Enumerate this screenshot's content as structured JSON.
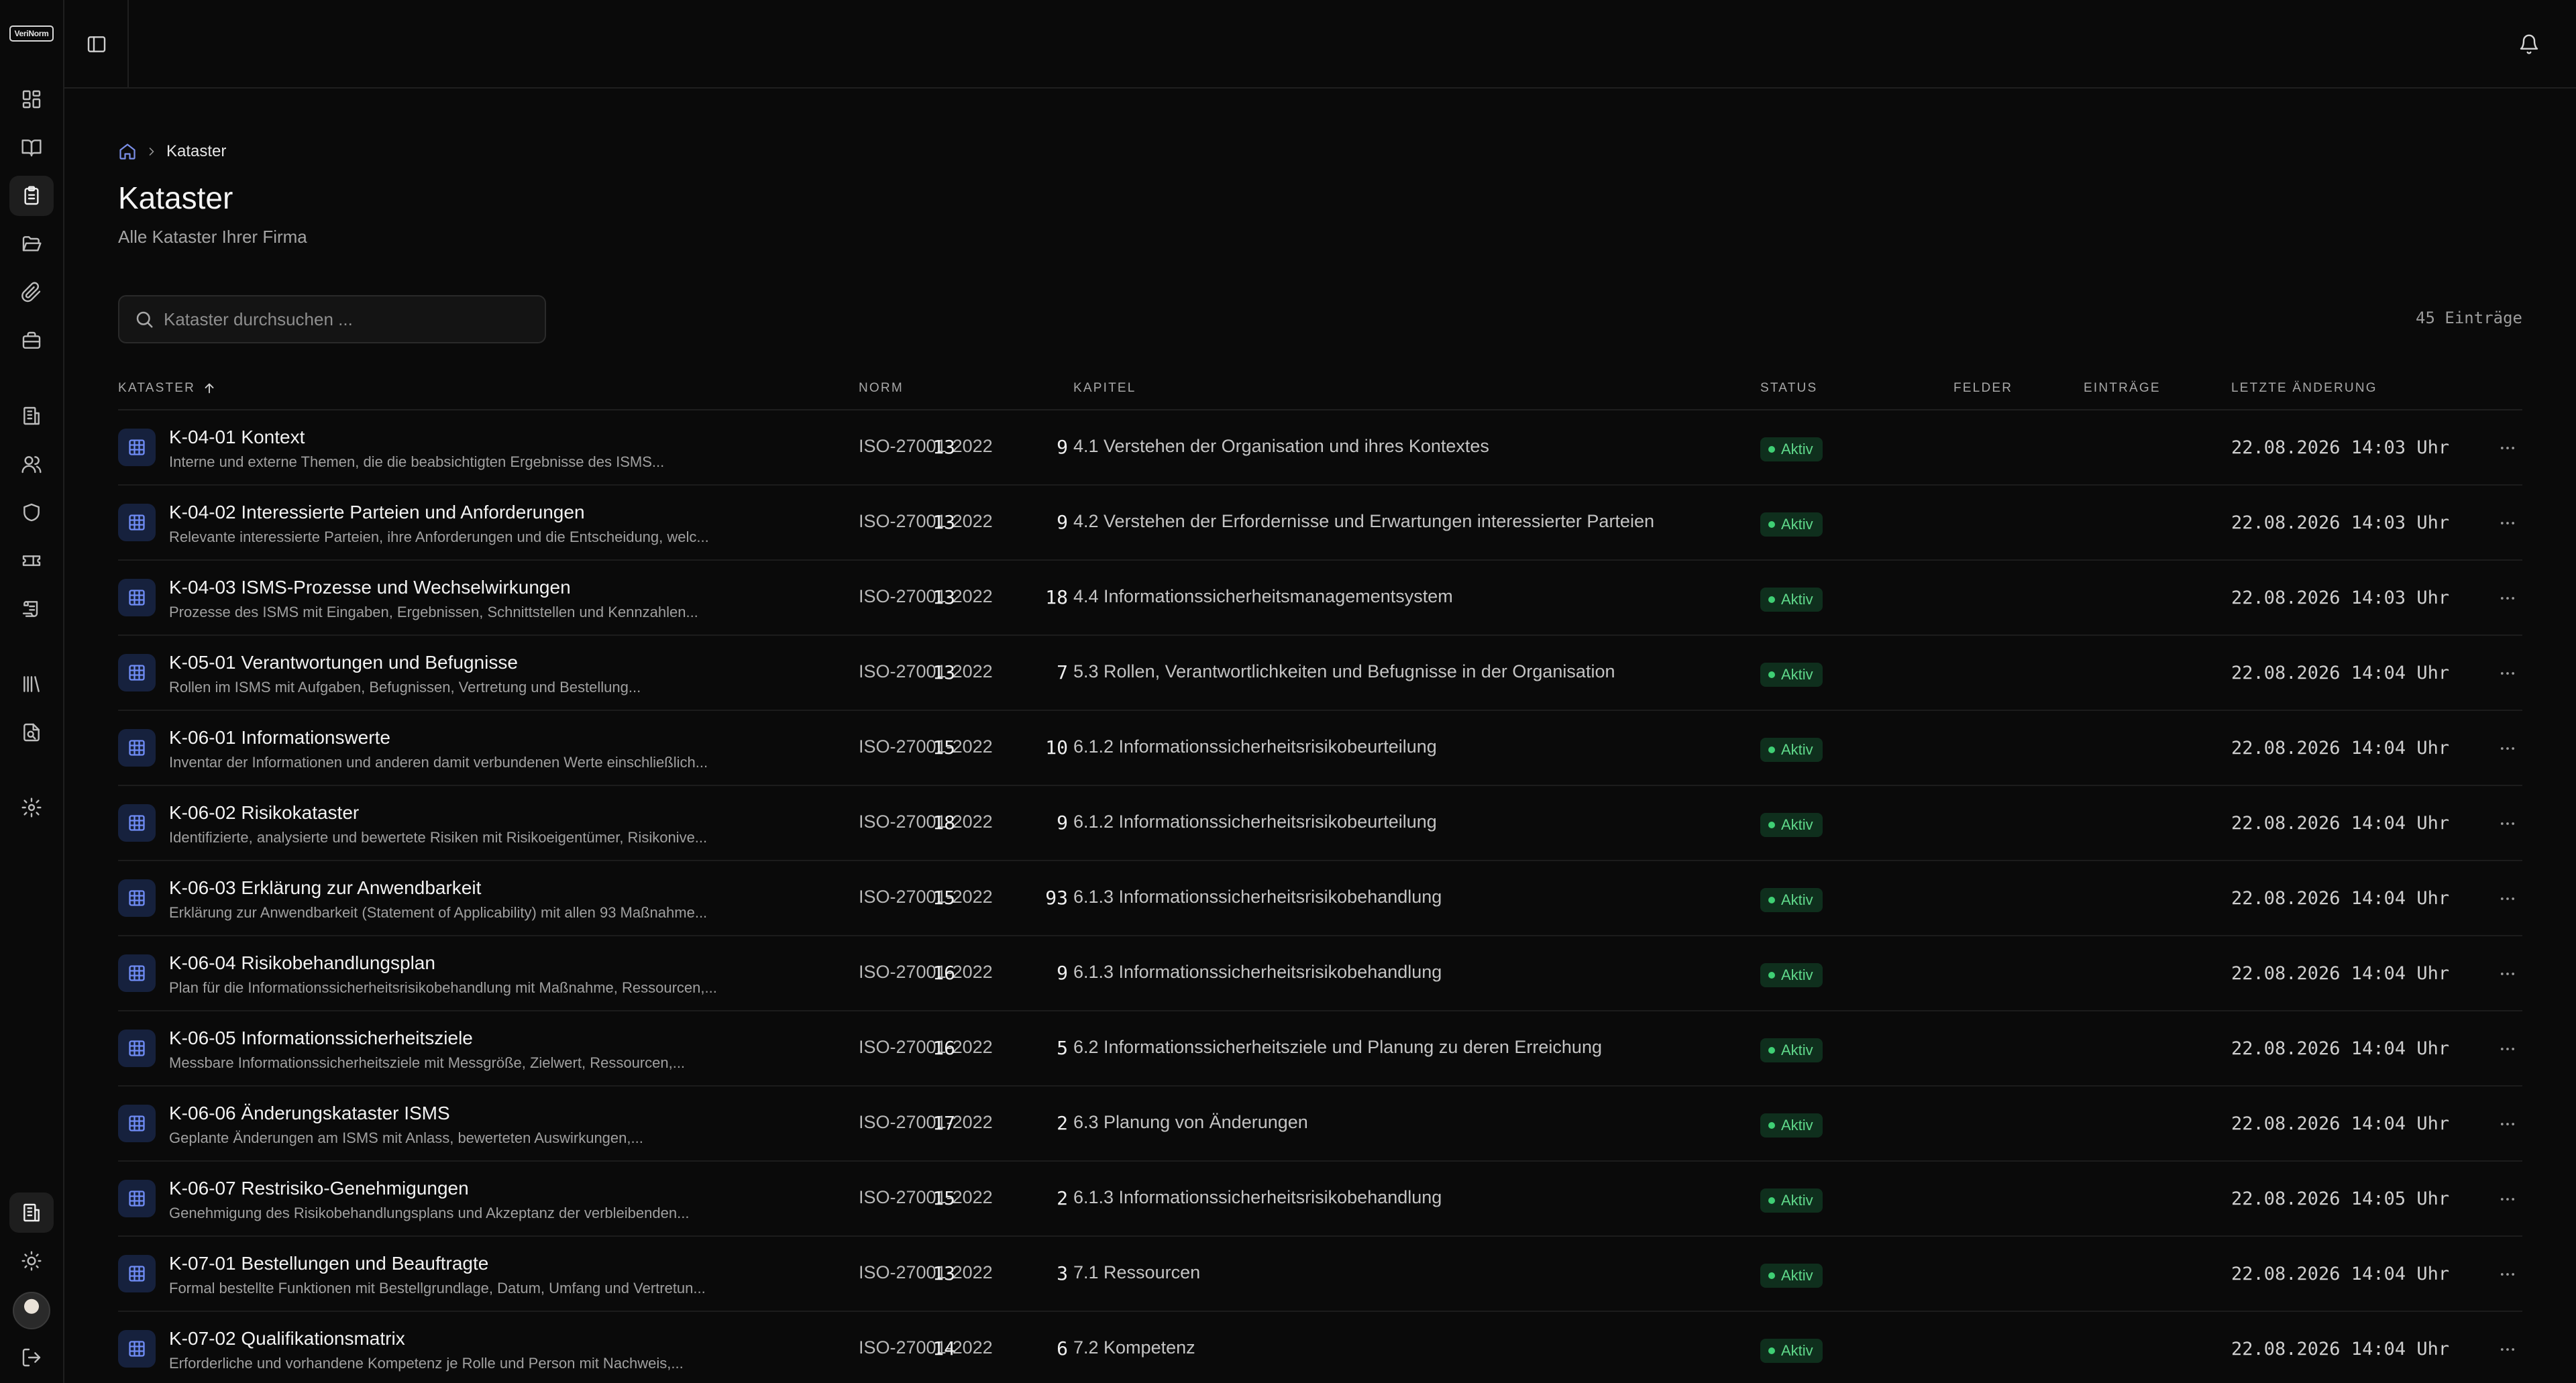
{
  "app": {
    "logo_text": "VeriNorm"
  },
  "topbar": {},
  "breadcrumb": {
    "current": "Kataster"
  },
  "page": {
    "title": "Kataster",
    "subtitle": "Alle Kataster Ihrer Firma"
  },
  "search": {
    "placeholder": "Kataster durchsuchen ..."
  },
  "count_label": "45 Einträge",
  "table": {
    "columns": {
      "kataster": "Kataster",
      "norm": "Norm",
      "kapitel": "Kapitel",
      "status": "Status",
      "felder": "Felder",
      "eintraege": "Einträge",
      "letzte_aenderung": "Letzte Änderung"
    },
    "rows": [
      {
        "title": "K-04-01 Kontext",
        "desc": "Interne und externe Themen, die die beabsichtigten Ergebnisse des ISMS...",
        "norm": "ISO-27001-2022",
        "kapitel": "4.1 Verstehen der Organisation und ihres Kontextes",
        "status": "Aktiv",
        "felder": "13",
        "eintraege": "9",
        "date": "22.08.2026 14:03 Uhr"
      },
      {
        "title": "K-04-02 Interessierte Parteien und Anforderungen",
        "desc": "Relevante interessierte Parteien, ihre Anforderungen und die Entscheidung, welc...",
        "norm": "ISO-27001-2022",
        "kapitel": "4.2 Verstehen der Erfordernisse und Erwartungen interessierter Parteien",
        "status": "Aktiv",
        "felder": "13",
        "eintraege": "9",
        "date": "22.08.2026 14:03 Uhr"
      },
      {
        "title": "K-04-03 ISMS-Prozesse und Wechselwirkungen",
        "desc": "Prozesse des ISMS mit Eingaben, Ergebnissen, Schnittstellen und Kennzahlen...",
        "norm": "ISO-27001-2022",
        "kapitel": "4.4 Informationssicherheitsmanagementsystem",
        "status": "Aktiv",
        "felder": "13",
        "eintraege": "18",
        "date": "22.08.2026 14:03 Uhr"
      },
      {
        "title": "K-05-01 Verantwortungen und Befugnisse",
        "desc": "Rollen im ISMS mit Aufgaben, Befugnissen, Vertretung und Bestellung...",
        "norm": "ISO-27001-2022",
        "kapitel": "5.3 Rollen, Verantwortlichkeiten und Befugnisse in der Organisation",
        "status": "Aktiv",
        "felder": "13",
        "eintraege": "7",
        "date": "22.08.2026 14:04 Uhr"
      },
      {
        "title": "K-06-01 Informationswerte",
        "desc": "Inventar der Informationen und anderen damit verbundenen Werte einschließlich...",
        "norm": "ISO-27001-2022",
        "kapitel": "6.1.2 Informationssicherheitsrisikobeurteilung",
        "status": "Aktiv",
        "felder": "15",
        "eintraege": "10",
        "date": "22.08.2026 14:04 Uhr"
      },
      {
        "title": "K-06-02 Risikokataster",
        "desc": "Identifizierte, analysierte und bewertete Risiken mit Risikoeigentümer, Risikonive...",
        "norm": "ISO-27001-2022",
        "kapitel": "6.1.2 Informationssicherheitsrisikobeurteilung",
        "status": "Aktiv",
        "felder": "18",
        "eintraege": "9",
        "date": "22.08.2026 14:04 Uhr"
      },
      {
        "title": "K-06-03 Erklärung zur Anwendbarkeit",
        "desc": "Erklärung zur Anwendbarkeit (Statement of Applicability) mit allen 93 Maßnahme...",
        "norm": "ISO-27001-2022",
        "kapitel": "6.1.3 Informationssicherheitsrisikobehandlung",
        "status": "Aktiv",
        "felder": "15",
        "eintraege": "93",
        "date": "22.08.2026 14:04 Uhr"
      },
      {
        "title": "K-06-04 Risikobehandlungsplan",
        "desc": "Plan für die Informationssicherheitsrisikobehandlung mit Maßnahme, Ressourcen,...",
        "norm": "ISO-27001-2022",
        "kapitel": "6.1.3 Informationssicherheitsrisikobehandlung",
        "status": "Aktiv",
        "felder": "16",
        "eintraege": "9",
        "date": "22.08.2026 14:04 Uhr"
      },
      {
        "title": "K-06-05 Informationssicherheitsziele",
        "desc": "Messbare Informationssicherheitsziele mit Messgröße, Zielwert, Ressourcen,...",
        "norm": "ISO-27001-2022",
        "kapitel": "6.2 Informationssicherheitsziele und Planung zu deren Erreichung",
        "status": "Aktiv",
        "felder": "16",
        "eintraege": "5",
        "date": "22.08.2026 14:04 Uhr"
      },
      {
        "title": "K-06-06 Änderungskataster ISMS",
        "desc": "Geplante Änderungen am ISMS mit Anlass, bewerteten Auswirkungen,...",
        "norm": "ISO-27001-2022",
        "kapitel": "6.3 Planung von Änderungen",
        "status": "Aktiv",
        "felder": "17",
        "eintraege": "2",
        "date": "22.08.2026 14:04 Uhr"
      },
      {
        "title": "K-06-07 Restrisiko-Genehmigungen",
        "desc": "Genehmigung des Risikobehandlungsplans und Akzeptanz der verbleibenden...",
        "norm": "ISO-27001-2022",
        "kapitel": "6.1.3 Informationssicherheitsrisikobehandlung",
        "status": "Aktiv",
        "felder": "15",
        "eintraege": "2",
        "date": "22.08.2026 14:05 Uhr"
      },
      {
        "title": "K-07-01 Bestellungen und Beauftragte",
        "desc": "Formal bestellte Funktionen mit Bestellgrundlage, Datum, Umfang und Vertretun...",
        "norm": "ISO-27001-2022",
        "kapitel": "7.1 Ressourcen",
        "status": "Aktiv",
        "felder": "13",
        "eintraege": "3",
        "date": "22.08.2026 14:04 Uhr"
      },
      {
        "title": "K-07-02 Qualifikationsmatrix",
        "desc": "Erforderliche und vorhandene Kompetenz je Rolle und Person mit Nachweis,...",
        "norm": "ISO-27001-2022",
        "kapitel": "7.2 Kompetenz",
        "status": "Aktiv",
        "felder": "14",
        "eintraege": "6",
        "date": "22.08.2026 14:04 Uhr"
      }
    ]
  },
  "colors": {
    "accent": "#6f8cf5",
    "status_active": "#3fcf74",
    "background": "#0a0a0a"
  },
  "icons": {
    "sidebar": [
      "dashboard-icon",
      "book-icon",
      "clipboard-icon",
      "folder-open-icon",
      "paperclip-icon",
      "briefcase-icon",
      "building-icon",
      "users-icon",
      "shield-icon",
      "ticket-icon",
      "scroll-icon",
      "library-icon",
      "file-search-icon",
      "settings-icon",
      "company-icon",
      "sun-icon",
      "logout-icon"
    ],
    "row": "table-grid-icon",
    "row_action": "more-horizontal-icon"
  }
}
